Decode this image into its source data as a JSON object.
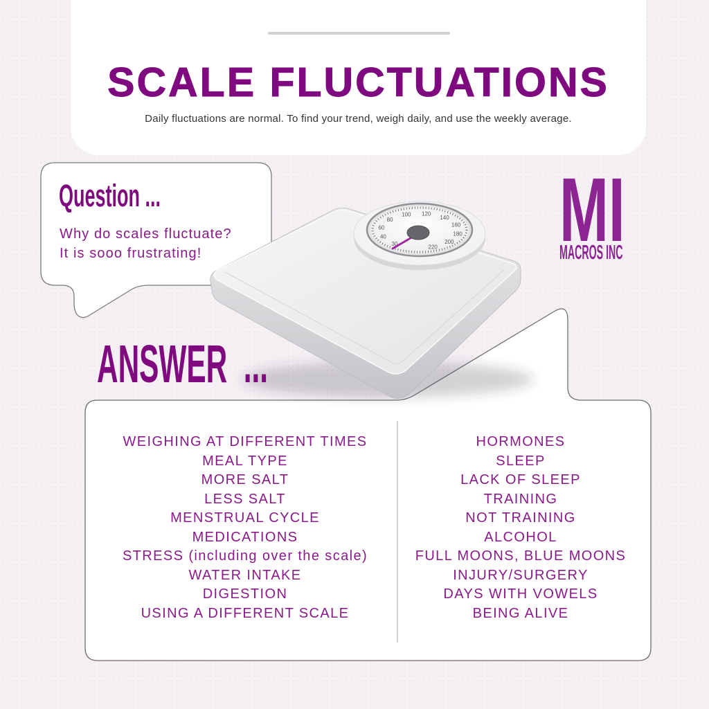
{
  "colors": {
    "primary": "#7f0a7f",
    "logo": "#8b2591",
    "text": "#8a1a8a",
    "subtitle": "#333333",
    "background": "#f4f0f4",
    "needle": "#a1279f"
  },
  "header": {
    "title": "SCALE FLUCTUATIONS",
    "subtitle": "Daily fluctuations are normal. To find your trend, weigh daily, and use the weekly average."
  },
  "question": {
    "heading": "Question ...",
    "lines": [
      "Why do scales fluctuate?",
      "It is sooo frustrating!"
    ]
  },
  "logo": {
    "mark": "MI",
    "name": "MACROS INC"
  },
  "scale_image": {
    "icon": "bathroom-scale-icon",
    "dial_labels": [
      "30",
      "40",
      "60",
      "80",
      "100",
      "120",
      "140",
      "160",
      "180",
      "200",
      "220"
    ]
  },
  "answer": {
    "heading": "ANSWER  ...",
    "left": [
      "WEIGHING AT DIFFERENT TIMES",
      "MEAL TYPE",
      "MORE SALT",
      "LESS SALT",
      "MENSTRUAL CYCLE",
      "MEDICATIONS",
      "STRESS (including over the scale)",
      "WATER INTAKE",
      "DIGESTION",
      "USING A DIFFERENT SCALE"
    ],
    "right": [
      "HORMONES",
      "SLEEP",
      "LACK OF SLEEP",
      "TRAINING",
      "NOT TRAINING",
      "ALCOHOL",
      "FULL MOONS, BLUE MOONS",
      "INJURY/SURGERY",
      "DAYS WITH VOWELS",
      "BEING ALIVE"
    ]
  }
}
